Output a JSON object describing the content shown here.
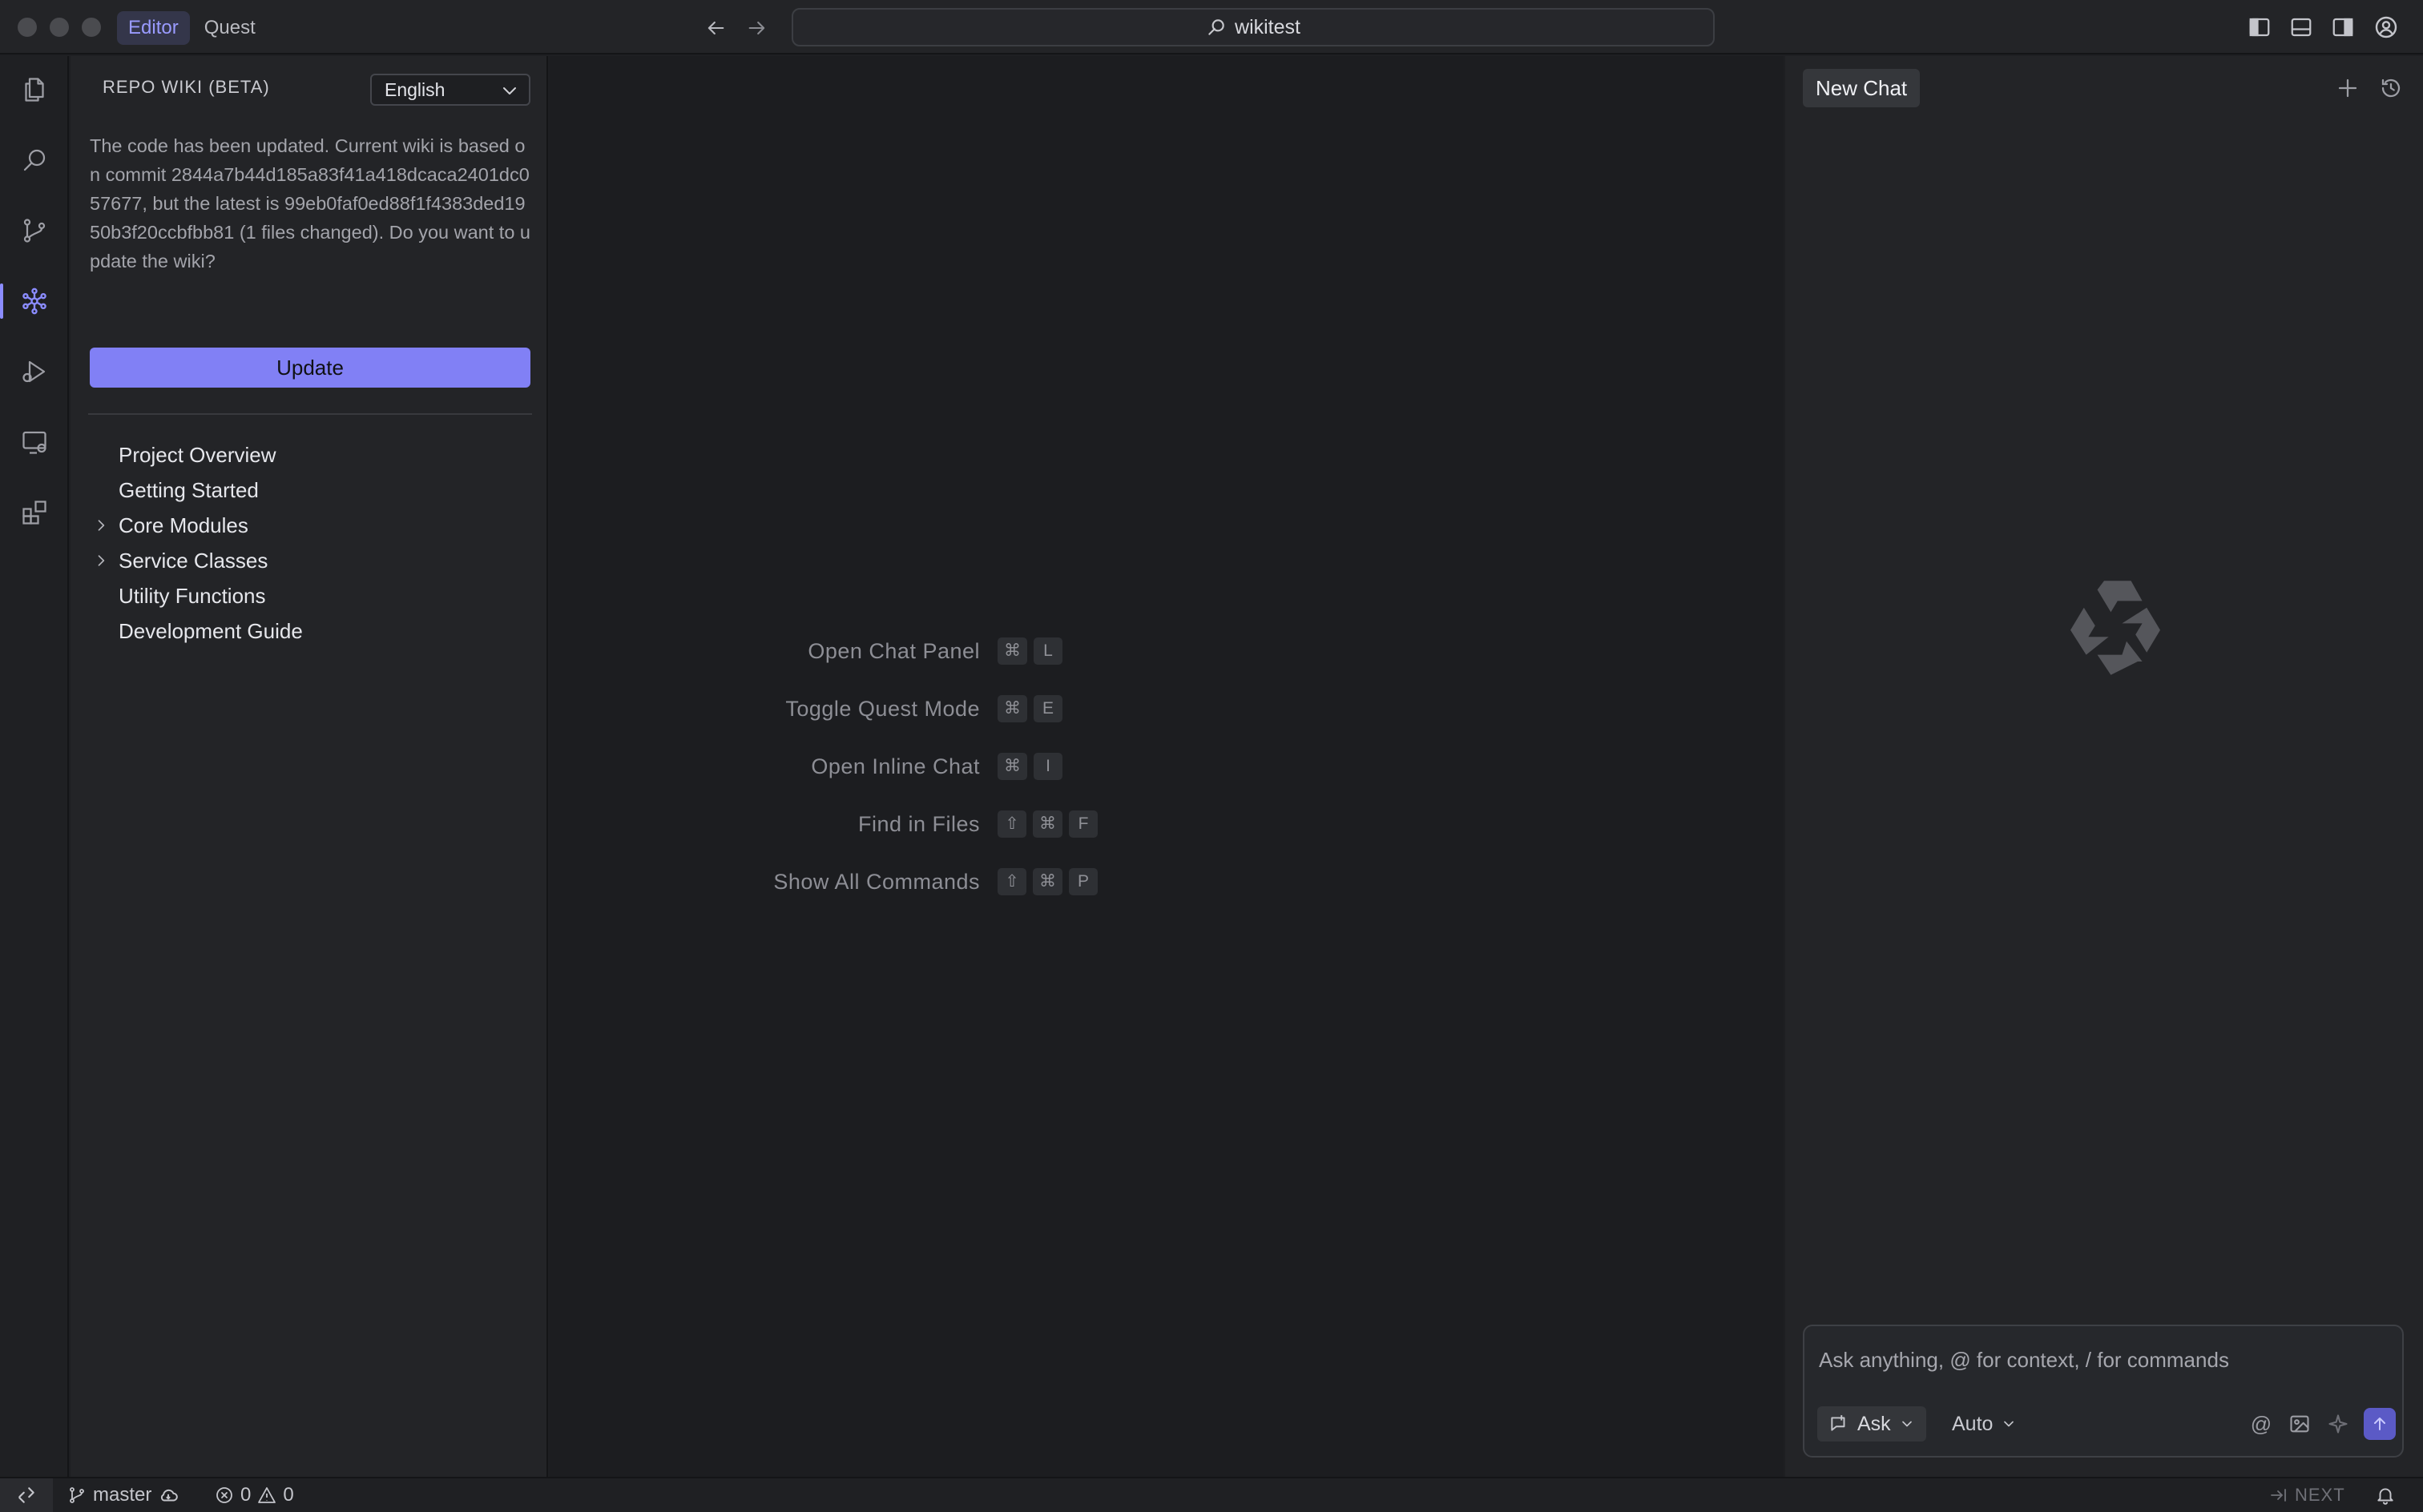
{
  "titlebar": {
    "modes": [
      "Editor",
      "Quest"
    ],
    "active_mode": "Editor",
    "search_text": "wikitest"
  },
  "sidebar": {
    "title": "REPO WIKI (BETA)",
    "language": "English",
    "notice": "The code has been updated. Current wiki is based on commit 2844a7b44d185a83f41a418dcaca2401dc057677, but the latest is 99eb0faf0ed88f1f4383ded1950b3f20ccbfbb81 (1 files changed). Do you want to update the wiki?",
    "update_label": "Update",
    "tree": [
      {
        "label": "Project Overview",
        "expandable": false
      },
      {
        "label": "Getting Started",
        "expandable": false
      },
      {
        "label": "Core Modules",
        "expandable": true
      },
      {
        "label": "Service Classes",
        "expandable": true
      },
      {
        "label": "Utility Functions",
        "expandable": false
      },
      {
        "label": "Development Guide",
        "expandable": false
      }
    ]
  },
  "editor": {
    "hints": [
      {
        "label": "Open Chat Panel",
        "keys": [
          "⌘",
          "L"
        ]
      },
      {
        "label": "Toggle Quest Mode",
        "keys": [
          "⌘",
          "E"
        ]
      },
      {
        "label": "Open Inline Chat",
        "keys": [
          "⌘",
          "I"
        ]
      },
      {
        "label": "Find in Files",
        "keys": [
          "⇧",
          "⌘",
          "F"
        ]
      },
      {
        "label": "Show All Commands",
        "keys": [
          "⇧",
          "⌘",
          "P"
        ]
      }
    ]
  },
  "chat": {
    "title": "New Chat",
    "placeholder": "Ask anything, @ for context, / for commands",
    "ask_label": "Ask",
    "model_label": "Auto",
    "at_symbol": "@"
  },
  "statusbar": {
    "branch": "master",
    "errors": "0",
    "warnings": "0",
    "next_label": "NEXT"
  },
  "colors": {
    "accent": "#8180f5",
    "background": "#1c1d20",
    "panel": "#232427"
  }
}
